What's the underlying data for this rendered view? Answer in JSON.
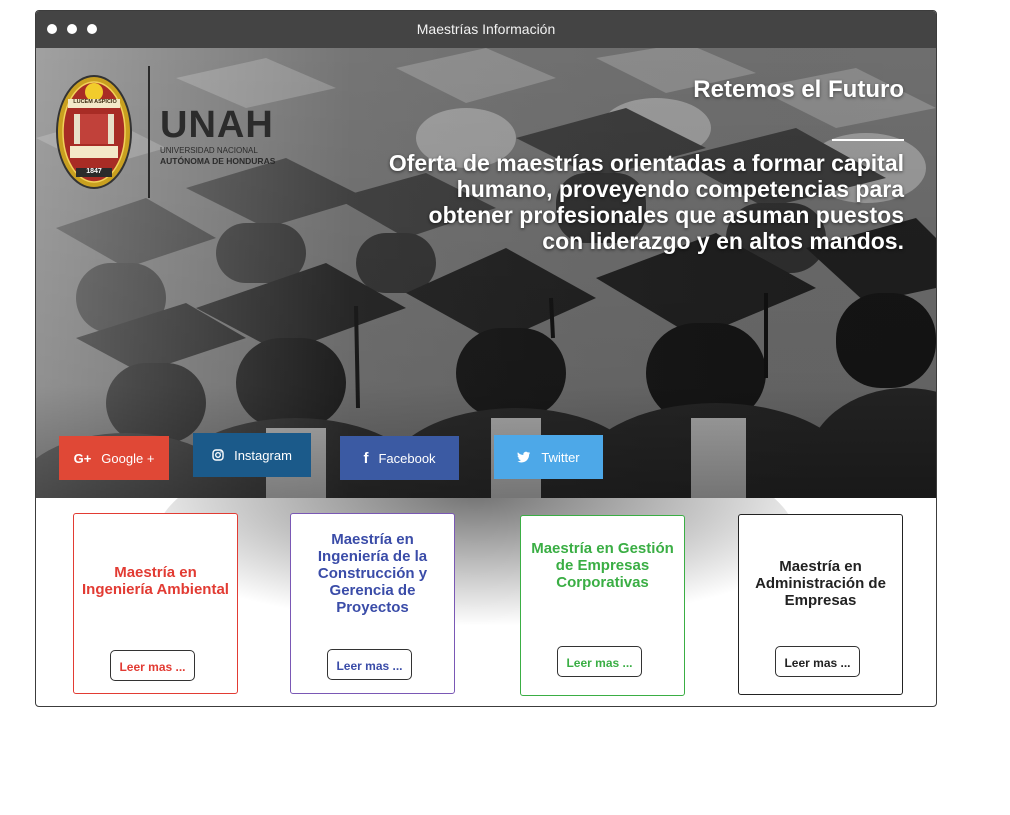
{
  "window": {
    "title": "Maestrías Información"
  },
  "brand": {
    "name": "UNAH",
    "subtitle_line1": "UNIVERSIDAD NACIONAL",
    "subtitle_line2": "AUTÓNOMA DE HONDURAS",
    "seal_motto": "LUCEM ASPICIO",
    "seal_year": "1847"
  },
  "hero": {
    "title": "Retemos el Futuro",
    "description": "Oferta de maestrías orientadas a formar capital humano, proveyendo competencias para obtener profesionales que asuman puestos con liderazgo y en altos mandos."
  },
  "social": [
    {
      "label": "Google +",
      "icon": "google-plus-icon",
      "color": "#e04836"
    },
    {
      "label": "Instagram",
      "icon": "instagram-icon",
      "color": "#1b5a8a"
    },
    {
      "label": "Facebook",
      "icon": "facebook-icon",
      "color": "#3b5aa3"
    },
    {
      "label": "Twitter",
      "icon": "twitter-icon",
      "color": "#4da8e8"
    }
  ],
  "cards": [
    {
      "title": "Maestría en Ingeniería Ambiental",
      "button": "Leer mas ...",
      "color": "#e23b33"
    },
    {
      "title": "Maestría en Ingeniería de la Construcción y Gerencia de Proyectos",
      "button": "Leer mas ...",
      "color": "#3a4ca8"
    },
    {
      "title": "Maestría en Gestión de Empresas Corporativas",
      "button": "Leer mas ...",
      "color": "#3aae44"
    },
    {
      "title": "Maestría en Administración de Empresas",
      "button": "Leer mas ...",
      "color": "#222222"
    }
  ]
}
